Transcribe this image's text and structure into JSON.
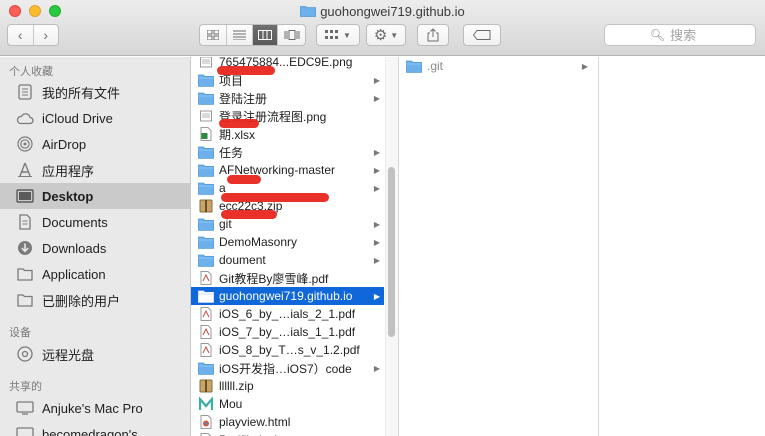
{
  "window": {
    "title": "guohongwei719.github.io"
  },
  "toolbar": {
    "search_placeholder": "搜索",
    "view_modes": [
      "icon-view-icon",
      "list-view-icon",
      "column-view-icon",
      "coverflow-view-icon"
    ],
    "active_view": "column-view-icon"
  },
  "sidebar": {
    "favorites_header": "个人收藏",
    "favorites": [
      {
        "label": "我的所有文件",
        "icon": "all-files-icon"
      },
      {
        "label": "iCloud Drive",
        "icon": "cloud-icon"
      },
      {
        "label": "AirDrop",
        "icon": "airdrop-icon"
      },
      {
        "label": "应用程序",
        "icon": "applications-icon"
      },
      {
        "label": "Desktop",
        "icon": "desktop-icon"
      },
      {
        "label": "Documents",
        "icon": "documents-icon"
      },
      {
        "label": "Downloads",
        "icon": "downloads-icon"
      },
      {
        "label": "Application",
        "icon": "folder-icon"
      },
      {
        "label": "已删除的用户",
        "icon": "folder-icon"
      }
    ],
    "devices_header": "设备",
    "devices": [
      {
        "label": "远程光盘",
        "icon": "disc-icon"
      }
    ],
    "shared_header": "共享的",
    "shared": [
      {
        "label": "Anjuke's Mac Pro",
        "icon": "computer-icon"
      },
      {
        "label": "becomedragon's",
        "icon": "computer-icon"
      }
    ],
    "selected": "Desktop"
  },
  "column1": {
    "items": [
      {
        "name": "765475884...EDC9E.png",
        "type": "image"
      },
      {
        "name": "项目",
        "type": "folder",
        "arrow": true
      },
      {
        "name": "登陆注册",
        "type": "folder",
        "arrow": true
      },
      {
        "name": "登录注册流程图.png",
        "type": "image"
      },
      {
        "name": "期.xlsx",
        "type": "excel"
      },
      {
        "name": "任务",
        "type": "folder",
        "arrow": true
      },
      {
        "name": "AFNetworking-master",
        "type": "folder",
        "arrow": true
      },
      {
        "name": "a",
        "type": "folder",
        "arrow": true
      },
      {
        "name": "ecc22c3.zip",
        "type": "zip"
      },
      {
        "name": "git",
        "type": "folder",
        "arrow": true
      },
      {
        "name": "DemoMasonry",
        "type": "folder",
        "arrow": true
      },
      {
        "name": "doument",
        "type": "folder",
        "arrow": true
      },
      {
        "name": "Git教程By廖雪峰.pdf",
        "type": "pdf"
      },
      {
        "name": "guohongwei719.github.io",
        "type": "folder",
        "arrow": true,
        "selected": true
      },
      {
        "name": "iOS_6_by_…ials_2_1.pdf",
        "type": "pdf"
      },
      {
        "name": "iOS_7_by_…ials_1_1.pdf",
        "type": "pdf"
      },
      {
        "name": "iOS_8_by_T…s_v_1.2.pdf",
        "type": "pdf"
      },
      {
        "name": "iOS开发指…iOS7）code",
        "type": "folder",
        "arrow": true
      },
      {
        "name": "llllll.zip",
        "type": "zip"
      },
      {
        "name": "Mou",
        "type": "mou-app"
      },
      {
        "name": "playview.html",
        "type": "html"
      },
      {
        "name": "Podfile.lock",
        "type": "doc"
      }
    ]
  },
  "column2": {
    "items": [
      {
        "name": ".git",
        "type": "folder",
        "arrow": true,
        "dimmed": true
      }
    ]
  },
  "colors": {
    "selection": "#1067d9",
    "folder": "#6cb1ec",
    "redaction": "#e8261e"
  }
}
